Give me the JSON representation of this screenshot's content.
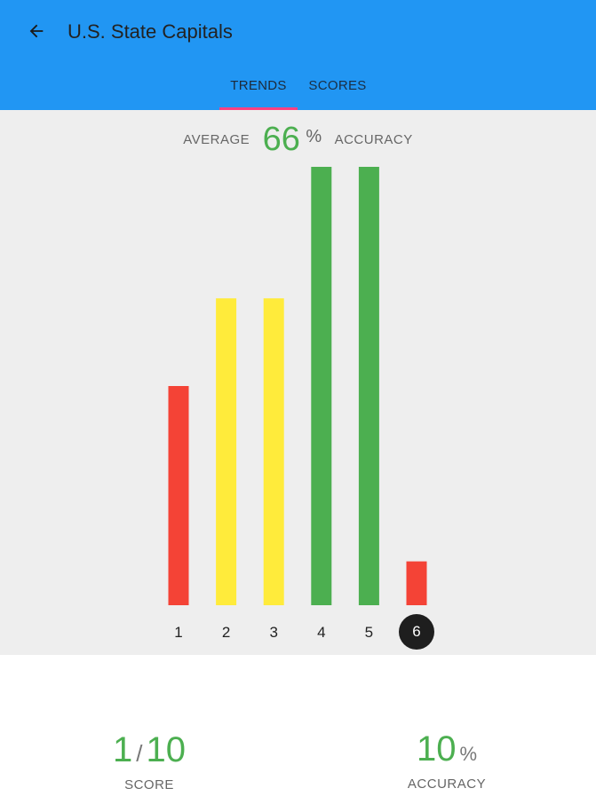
{
  "header": {
    "title": "U.S. State Capitals",
    "back_icon": "arrow-back-icon",
    "color": "#2196f3"
  },
  "tabs": [
    {
      "label": "TRENDS",
      "active": true
    },
    {
      "label": "SCORES",
      "active": false
    }
  ],
  "average": {
    "label": "AVERAGE",
    "value": "66",
    "unit": "%",
    "suffix": "ACCURACY"
  },
  "chart_data": {
    "type": "bar",
    "categories": [
      "1",
      "2",
      "3",
      "4",
      "5",
      "6"
    ],
    "values": [
      50,
      70,
      70,
      100,
      100,
      10
    ],
    "colors": [
      "#f44336",
      "#ffeb3b",
      "#ffeb3b",
      "#4caf50",
      "#4caf50",
      "#f44336"
    ],
    "selected": "6",
    "ylim": [
      0,
      100
    ]
  },
  "stats": {
    "score": {
      "value": "1",
      "separator": "/",
      "total": "10",
      "label": "SCORE"
    },
    "accuracy": {
      "value": "10",
      "unit": "%",
      "label": "ACCURACY"
    }
  }
}
